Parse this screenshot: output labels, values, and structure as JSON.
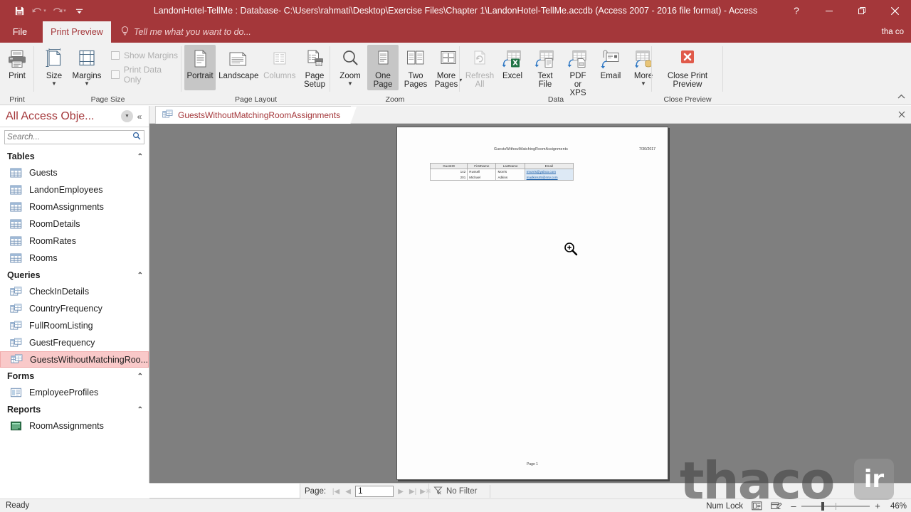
{
  "window": {
    "title": "LandonHotel-TellMe : Database- C:\\Users\\rahmati\\Desktop\\Exercise Files\\Chapter 1\\LandonHotel-TellMe.accdb (Access 2007 - 2016 file format) - Access",
    "help_label": "?",
    "minimize_label": "–",
    "restore_label": "❐",
    "close_label": "✕",
    "accent_color": "#a4373a"
  },
  "quick_access": {
    "save": "save-icon",
    "undo": "undo-icon",
    "redo": "redo-icon",
    "customize": "customize-icon"
  },
  "tabs": {
    "file": "File",
    "active": "Print Preview",
    "tellme_placeholder": "Tell me what you want to do...",
    "user_account": "tha co"
  },
  "ribbon": {
    "collapse_icon": "chevron-up-icon",
    "groups": [
      {
        "name": "Print",
        "buttons": [
          {
            "label": "Print",
            "icon": "printer-icon",
            "state": "normal",
            "caret": false
          }
        ]
      },
      {
        "name": "Page Size",
        "buttons": [
          {
            "label": "Size",
            "icon": "page-size-icon",
            "state": "normal",
            "caret": true
          },
          {
            "label": "Margins",
            "icon": "margins-icon",
            "state": "normal",
            "caret": true
          }
        ],
        "checkboxes": [
          {
            "label": "Show Margins",
            "checked": false,
            "disabled": true
          },
          {
            "label": "Print Data Only",
            "checked": false,
            "disabled": true
          }
        ]
      },
      {
        "name": "Page Layout",
        "buttons": [
          {
            "label": "Portrait",
            "icon": "portrait-icon",
            "state": "selected",
            "caret": false
          },
          {
            "label": "Landscape",
            "icon": "landscape-icon",
            "state": "normal",
            "caret": false
          },
          {
            "label": "Columns",
            "icon": "columns-icon",
            "state": "disabled",
            "caret": false
          },
          {
            "label": "Page\nSetup",
            "icon": "page-setup-icon",
            "state": "normal",
            "caret": false
          }
        ]
      },
      {
        "name": "Zoom",
        "buttons": [
          {
            "label": "Zoom",
            "icon": "magnifier-icon",
            "state": "normal",
            "caret": true
          },
          {
            "label": "One\nPage",
            "icon": "one-page-icon",
            "state": "selected",
            "caret": false
          },
          {
            "label": "Two\nPages",
            "icon": "two-pages-icon",
            "state": "normal",
            "caret": false
          },
          {
            "label": "More\nPages",
            "icon": "more-pages-icon",
            "state": "normal",
            "caret": true
          }
        ]
      },
      {
        "name": "Data",
        "buttons": [
          {
            "label": "Refresh\nAll",
            "icon": "refresh-icon",
            "state": "disabled",
            "caret": false
          },
          {
            "label": "Excel",
            "icon": "excel-icon",
            "state": "normal",
            "caret": false
          },
          {
            "label": "Text\nFile",
            "icon": "text-file-icon",
            "state": "normal",
            "caret": false
          },
          {
            "label": "PDF\nor XPS",
            "icon": "pdf-xps-icon",
            "state": "normal",
            "caret": false
          },
          {
            "label": "Email",
            "icon": "email-icon",
            "state": "normal",
            "caret": false
          },
          {
            "label": "More",
            "icon": "more-data-icon",
            "state": "normal",
            "caret": true
          }
        ]
      },
      {
        "name": "Close Preview",
        "buttons": [
          {
            "label": "Close Print\nPreview",
            "icon": "close-preview-icon",
            "state": "normal",
            "caret": false
          }
        ]
      }
    ]
  },
  "navpane": {
    "title": "All Access Obje...",
    "dropdown_icon": "chevron-down-circle-icon",
    "shrink_icon": "double-chevron-left-icon",
    "search_placeholder": "Search...",
    "search_value": "",
    "search_icon": "search-icon",
    "groups": [
      {
        "label": "Tables",
        "collapse_icon": "chevron-up-icon",
        "items": [
          {
            "label": "Guests",
            "icon": "table-icon",
            "selected": false
          },
          {
            "label": "LandonEmployees",
            "icon": "table-icon",
            "selected": false
          },
          {
            "label": "RoomAssignments",
            "icon": "table-icon",
            "selected": false
          },
          {
            "label": "RoomDetails",
            "icon": "table-icon",
            "selected": false
          },
          {
            "label": "RoomRates",
            "icon": "table-icon",
            "selected": false
          },
          {
            "label": "Rooms",
            "icon": "table-icon",
            "selected": false
          }
        ]
      },
      {
        "label": "Queries",
        "collapse_icon": "chevron-up-icon",
        "items": [
          {
            "label": "CheckInDetails",
            "icon": "query-icon",
            "selected": false
          },
          {
            "label": "CountryFrequency",
            "icon": "query-icon",
            "selected": false
          },
          {
            "label": "FullRoomListing",
            "icon": "query-icon",
            "selected": false
          },
          {
            "label": "GuestFrequency",
            "icon": "query-icon",
            "selected": false
          },
          {
            "label": "GuestsWithoutMatchingRoo...",
            "icon": "query-icon",
            "selected": true
          }
        ]
      },
      {
        "label": "Forms",
        "collapse_icon": "chevron-up-icon",
        "items": [
          {
            "label": "EmployeeProfiles",
            "icon": "form-icon",
            "selected": false
          }
        ]
      },
      {
        "label": "Reports",
        "collapse_icon": "chevron-up-icon",
        "items": [
          {
            "label": "RoomAssignments",
            "icon": "report-icon",
            "selected": false
          }
        ]
      }
    ]
  },
  "doctab": {
    "label": "GuestsWithoutMatchingRoomAssignments",
    "icon": "query-icon",
    "close_label": "✕"
  },
  "report": {
    "title": "GuestsWithoutMatchingRoomAssignments",
    "date": "7/30/2017",
    "page_footer": "Page 1",
    "columns": [
      "GuestID",
      "FirstName",
      "LastName",
      "Email"
    ],
    "rows": [
      {
        "GuestID": "142",
        "FirstName": "Russell",
        "LastName": "Morris",
        "Email": "rmorris@yahoo.com"
      },
      {
        "GuestID": "201",
        "FirstName": "Michael",
        "LastName": "Adkins",
        "Email": "madkins45@mtv.com"
      }
    ]
  },
  "recordnav": {
    "page_label": "Page:",
    "first_icon": "first-record-icon",
    "prev_icon": "previous-record-icon",
    "page_value": "1",
    "next_icon": "next-record-icon",
    "last_icon": "last-record-icon",
    "new_icon": "new-record-icon",
    "filter_icon": "filter-icon",
    "filter_label": "No Filter"
  },
  "statusbar": {
    "ready": "Ready",
    "numlock": "Num Lock",
    "view_icons": [
      "report-view-icon",
      "layout-view-icon"
    ],
    "zoom_minus": "–",
    "zoom_plus": "+",
    "zoom_percent": "46%"
  },
  "watermark": {
    "text": "thaco",
    "badge": "ir"
  }
}
